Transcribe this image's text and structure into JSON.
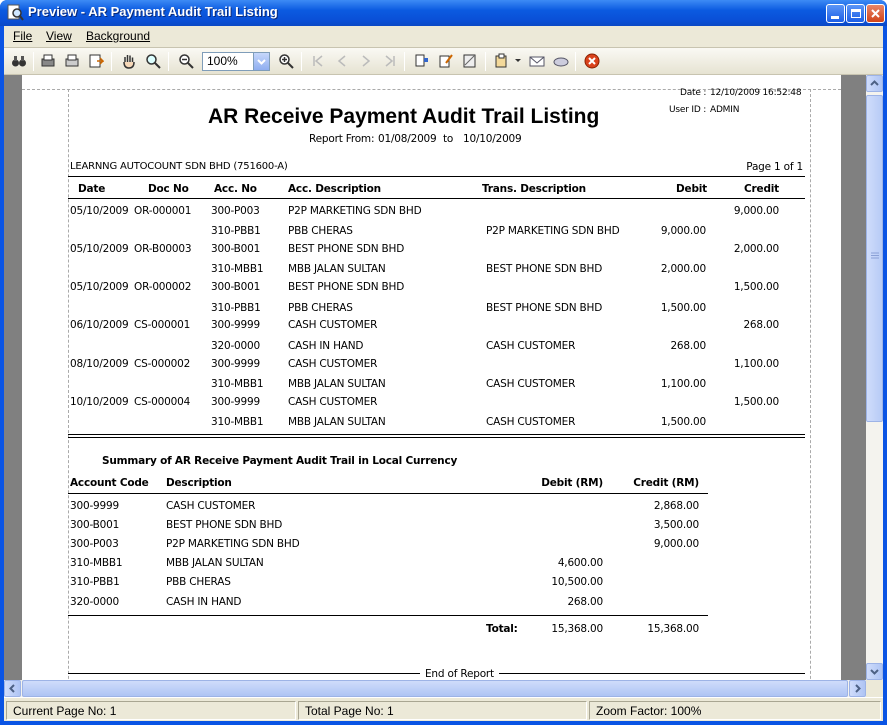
{
  "window": {
    "title": "Preview - AR Payment Audit Trail Listing"
  },
  "menu": [
    "File",
    "View",
    "Background"
  ],
  "toolbar": {
    "zoom": "100%"
  },
  "report": {
    "date_label": "Date :",
    "date_value": "12/10/2009 16:52:48",
    "user_label": "User ID :",
    "user_value": "ADMIN",
    "title": "AR Receive Payment Audit Trail Listing",
    "range_prefix": "Report From:",
    "range_from": "01/08/2009",
    "range_to_word": "to",
    "range_to": "10/10/2009",
    "company": "LEARNNG AUTOCOUNT SDN BHD (751600-A)",
    "page": "Page 1 of 1",
    "columns": [
      "Date",
      "Doc No",
      "Acc. No",
      "Acc. Description",
      "Trans. Description",
      "Debit",
      "Credit"
    ],
    "rows": [
      {
        "date": "05/10/2009",
        "doc": "OR-000001",
        "acc": "300-P003",
        "desc": "P2P MARKETING SDN BHD",
        "trans": "",
        "debit": "",
        "credit": "9,000.00"
      },
      {
        "date": "",
        "doc": "",
        "acc": "310-PBB1",
        "desc": "PBB CHERAS",
        "trans": "P2P MARKETING SDN BHD",
        "debit": "9,000.00",
        "credit": ""
      },
      {
        "date": "05/10/2009",
        "doc": "OR-B00003",
        "acc": "300-B001",
        "desc": "BEST PHONE SDN BHD",
        "trans": "",
        "debit": "",
        "credit": "2,000.00"
      },
      {
        "date": "",
        "doc": "",
        "acc": "310-MBB1",
        "desc": "MBB JALAN SULTAN",
        "trans": "BEST PHONE SDN BHD",
        "debit": "2,000.00",
        "credit": ""
      },
      {
        "date": "05/10/2009",
        "doc": "OR-000002",
        "acc": "300-B001",
        "desc": "BEST PHONE SDN BHD",
        "trans": "",
        "debit": "",
        "credit": "1,500.00"
      },
      {
        "date": "",
        "doc": "",
        "acc": "310-PBB1",
        "desc": "PBB CHERAS",
        "trans": "BEST PHONE SDN BHD",
        "debit": "1,500.00",
        "credit": ""
      },
      {
        "date": "06/10/2009",
        "doc": "CS-000001",
        "acc": "300-9999",
        "desc": "CASH CUSTOMER",
        "trans": "",
        "debit": "",
        "credit": "268.00"
      },
      {
        "date": "",
        "doc": "",
        "acc": "320-0000",
        "desc": "CASH IN HAND",
        "trans": "CASH CUSTOMER",
        "debit": "268.00",
        "credit": ""
      },
      {
        "date": "08/10/2009",
        "doc": "CS-000002",
        "acc": "300-9999",
        "desc": "CASH CUSTOMER",
        "trans": "",
        "debit": "",
        "credit": "1,100.00"
      },
      {
        "date": "",
        "doc": "",
        "acc": "310-MBB1",
        "desc": "MBB JALAN SULTAN",
        "trans": "CASH CUSTOMER",
        "debit": "1,100.00",
        "credit": ""
      },
      {
        "date": "10/10/2009",
        "doc": "CS-000004",
        "acc": "300-9999",
        "desc": "CASH CUSTOMER",
        "trans": "",
        "debit": "",
        "credit": "1,500.00"
      },
      {
        "date": "",
        "doc": "",
        "acc": "310-MBB1",
        "desc": "MBB JALAN SULTAN",
        "trans": "CASH CUSTOMER",
        "debit": "1,500.00",
        "credit": ""
      }
    ],
    "summary_title": "Summary of AR Receive Payment Audit Trail in Local Currency",
    "summary_columns": [
      "Account Code",
      "Description",
      "Debit (RM)",
      "Credit (RM)"
    ],
    "summary_rows": [
      {
        "code": "300-9999",
        "desc": "CASH CUSTOMER",
        "debit": "",
        "credit": "2,868.00"
      },
      {
        "code": "300-B001",
        "desc": "BEST PHONE SDN BHD",
        "debit": "",
        "credit": "3,500.00"
      },
      {
        "code": "300-P003",
        "desc": "P2P MARKETING SDN BHD",
        "debit": "",
        "credit": "9,000.00"
      },
      {
        "code": "310-MBB1",
        "desc": "MBB JALAN SULTAN",
        "debit": "4,600.00",
        "credit": ""
      },
      {
        "code": "310-PBB1",
        "desc": "PBB CHERAS",
        "debit": "10,500.00",
        "credit": ""
      },
      {
        "code": "320-0000",
        "desc": "CASH IN HAND",
        "debit": "268.00",
        "credit": ""
      }
    ],
    "total_label": "Total:",
    "total_debit": "15,368.00",
    "total_credit": "15,368.00",
    "end": "End of Report"
  },
  "status": {
    "current": "Current Page No: 1",
    "total": "Total Page No: 1",
    "zoom": "Zoom Factor: 100%"
  }
}
